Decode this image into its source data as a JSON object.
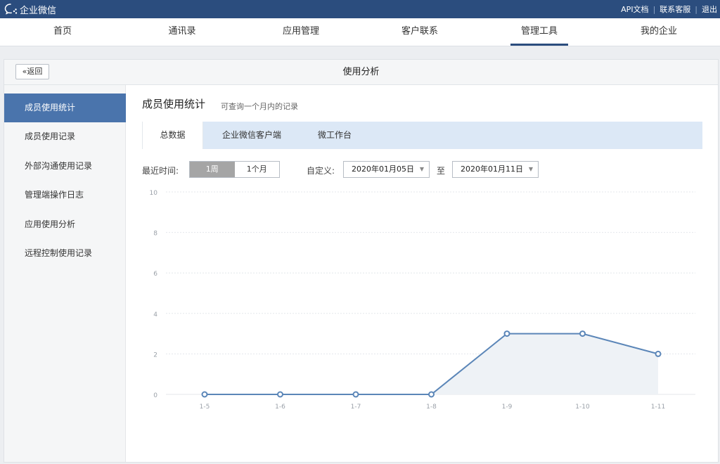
{
  "brand": {
    "name": "企业微信"
  },
  "toplinks": {
    "api": "API文档",
    "contact": "联系客服",
    "logout": "退出"
  },
  "nav": [
    "首页",
    "通讯录",
    "应用管理",
    "客户联系",
    "管理工具",
    "我的企业"
  ],
  "nav_active": 4,
  "panel": {
    "back": "返回",
    "title": "使用分析"
  },
  "sidebar": [
    "成员使用统计",
    "成员使用记录",
    "外部沟通使用记录",
    "管理端操作日志",
    "应用使用分析",
    "远程控制使用记录"
  ],
  "sidebar_active": 0,
  "section": {
    "title": "成员使用统计",
    "subtitle": "可查询一个月内的记录"
  },
  "tabs": [
    "总数据",
    "企业微信客户端",
    "微工作台"
  ],
  "filter": {
    "recent_label": "最近时间:",
    "week": "1周",
    "month": "1个月",
    "custom_label": "自定义:",
    "start_date": "2020年01月05日",
    "to": "至",
    "end_date": "2020年01月11日"
  },
  "colors": {
    "brand": "#2b4d7e",
    "accent": "#4a74ac",
    "line": "#5b86b8",
    "area": "#eef2f6"
  },
  "chart_data": {
    "type": "area",
    "categories": [
      "1-5",
      "1-6",
      "1-7",
      "1-8",
      "1-9",
      "1-10",
      "1-11"
    ],
    "values": [
      0,
      0,
      0,
      0,
      3,
      3,
      2
    ],
    "yticks": [
      "0",
      "2",
      "4",
      "6",
      "8",
      "10"
    ],
    "ylim": [
      0,
      10
    ],
    "grid": true
  }
}
